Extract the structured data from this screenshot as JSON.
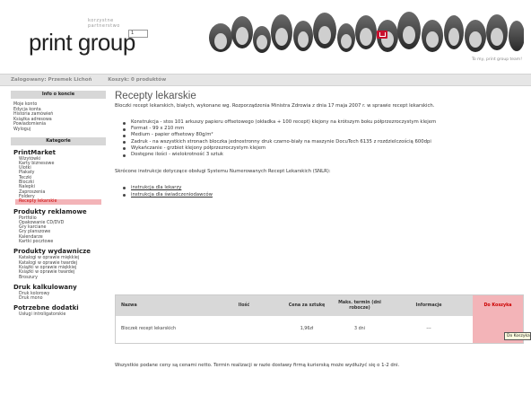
{
  "header": {
    "tagline": "korzystne partnerstwo",
    "logo_word1": "print",
    "logo_word2": "group",
    "top_link": "To my, print group team!"
  },
  "userbar": {
    "logged_in": "Zalogowany: Przemek Lichoń",
    "cart": "Koszyk: 0 produktów"
  },
  "sidebar": {
    "account_header": "Info o koncie",
    "account_items": [
      "Moje konto",
      "Edycja konta",
      "Historia zamówień",
      "Książka adresowa",
      "Powiadomienia",
      "Wyloguj"
    ],
    "categories_header": "Kategorie",
    "groups": [
      {
        "title": "PrintMarket",
        "items": [
          "Wizytówki",
          "Karty biznesowe",
          "Ulotki",
          "Plakaty",
          "Teczki",
          "Bloczki",
          "Nalepki",
          "Zaproszenia",
          "Foldery",
          "Recepty lekarskie"
        ]
      },
      {
        "title": "Produkty reklamowe",
        "items": [
          "Portfolio",
          "Opakowanie CD/DVD",
          "Gry karciane",
          "Gry planszowe",
          "Kalendarze",
          "Kartki pocztowe"
        ]
      },
      {
        "title": "Produkty wydawnicze",
        "items": [
          "Katalogi w oprawie miękkiej",
          "Katalogi w oprawie twardej",
          "Książki w oprawie miękkiej",
          "Książki w oprawie twardej",
          "Broszury"
        ]
      },
      {
        "title": "Druk kalkulowany",
        "items": [
          "Druk kolorowy",
          "Druk mono"
        ]
      },
      {
        "title": "Potrzebne dodatki",
        "items": [
          "Usługi introligatorskie"
        ]
      }
    ],
    "active_item": "Recepty lekarskie"
  },
  "main": {
    "title": "Recepty lekarskie",
    "intro": "Bloczki recept lekarskich, białych, wykonane wg. Rozporządzenia Ministra Zdrowia z dnia 17 maja 2007 r. w sprawie recept lekarskich.",
    "bullets": [
      "Konstrukcja - stos 101 arkuszy papieru offsetowego (okładka + 100 recept) klejony na krótszym boku półprzezroczystym klejem",
      "Format - 99 x 210 mm",
      "Medium - papier offsetowy 80g/m²",
      "Zadruk - na wszystkich stronach bloczka jednostronny druk czarno-biały na maszynie DocuTech 6135 z rozdzielczością 600dpi",
      "Wykańczanie - grzbiet klejony półprzezroczystym klejem",
      "Dostępne ilości - wielokrotność 3 sztuk"
    ],
    "snlr_text": "Skrócone instrukcje dotyczące obsługi Systemu Numerowanych Recept Lekarskich (SNLR):",
    "links": [
      "instrukcja dla lekarzy",
      "instrukcja dla świadczeniodawców"
    ]
  },
  "table": {
    "headers": {
      "name": "Nazwa",
      "qty": "Ilość",
      "unit_price": "Cena za sztukę",
      "deadline": "Maks. termin (dni robocze)",
      "info": "Informacje",
      "cart": "Do Koszyka"
    },
    "row": {
      "name": "Bloczek recept lekarskich",
      "qty": "1",
      "unit_price": "1,96zł",
      "deadline": "3 dni",
      "info": "---"
    },
    "tooltip": "Do Koszyka"
  },
  "footnote": "Wszystkie podane ceny są cenami netto. Termin realizacji w razie dostawy firmą kurierską może wydłużyć się o 1-2 dni.",
  "colors": {
    "highlight": "#f3b4b8",
    "cart_button": "#c8102e",
    "bar": "#e6e6e6"
  }
}
